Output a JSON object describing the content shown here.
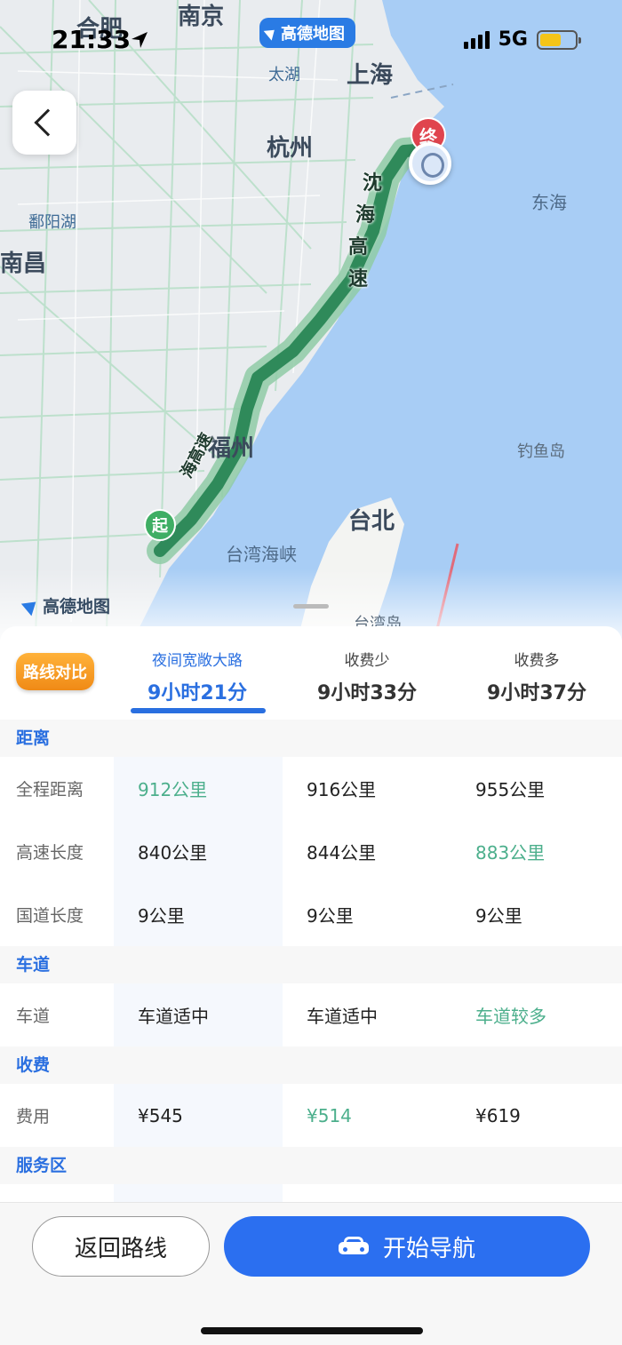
{
  "status": {
    "time": "21:33",
    "network": "5G"
  },
  "map": {
    "brand": "高德地图",
    "watermark": "高德地图",
    "cities": [
      "合肥",
      "南京",
      "太湖",
      "上海",
      "杭州",
      "鄱阳湖",
      "南昌",
      "东海",
      "福州",
      "台北",
      "台湾海峡",
      "钓鱼岛",
      "台湾岛"
    ],
    "route_label_north": [
      "沈",
      "海",
      "高",
      "速"
    ],
    "route_label_south": "海高速",
    "start_marker": "起",
    "end_marker": "终"
  },
  "compare_badge": "路线对比",
  "routes": [
    {
      "sub": "夜间宽敞大路",
      "duration": "9小时21分"
    },
    {
      "sub": "收费少",
      "duration": "9小时33分"
    },
    {
      "sub": "收费多",
      "duration": "9小时37分"
    }
  ],
  "sections": {
    "distance": "距离",
    "lane": "车道",
    "fee": "收费",
    "service": "服务区"
  },
  "rows": {
    "total_distance": {
      "label": "全程距离",
      "values": [
        "912公里",
        "916公里",
        "955公里"
      ]
    },
    "highway_length": {
      "label": "高速长度",
      "values": [
        "840公里",
        "844公里",
        "883公里"
      ]
    },
    "national_length": {
      "label": "国道长度",
      "values": [
        "9公里",
        "9公里",
        "9公里"
      ]
    },
    "lanes": {
      "label": "车道",
      "values": [
        "车道适中",
        "车道适中",
        "车道较多"
      ]
    },
    "cost": {
      "label": "费用",
      "values": [
        "¥545",
        "¥514",
        "¥619"
      ]
    }
  },
  "buttons": {
    "back": "返回路线",
    "navigate": "开始导航"
  },
  "colors": {
    "accent": "#2a6fe0",
    "highlight": "#4caf8c",
    "route": "#2f8a5a"
  }
}
